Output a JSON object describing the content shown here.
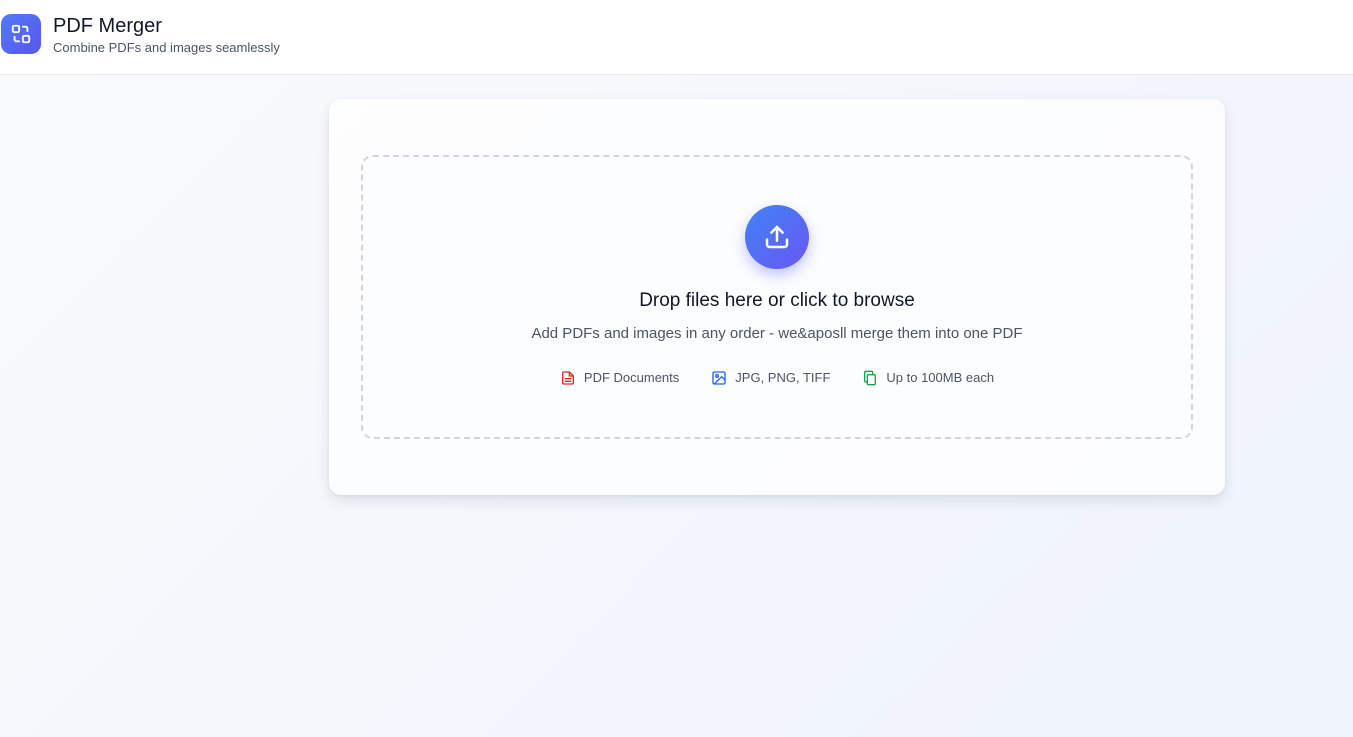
{
  "header": {
    "title": "PDF Merger",
    "subtitle": "Combine PDFs and images seamlessly",
    "logo_icon": "merge-icon"
  },
  "dropzone": {
    "icon": "upload-icon",
    "title": "Drop files here or click to browse",
    "subtitle": "Add PDFs and images in any order - we&aposll merge them into one PDF",
    "features": [
      {
        "label": "PDF Documents",
        "icon": "file-text-icon",
        "color": "#dc2626"
      },
      {
        "label": "JPG, PNG, TIFF",
        "icon": "image-icon",
        "color": "#2563eb"
      },
      {
        "label": "Up to 100MB each",
        "icon": "files-icon",
        "color": "#16a34a"
      }
    ]
  },
  "colors": {
    "accent_start": "#3f84f5",
    "accent_end": "#6a56f2",
    "background": "#f5f7fb"
  }
}
